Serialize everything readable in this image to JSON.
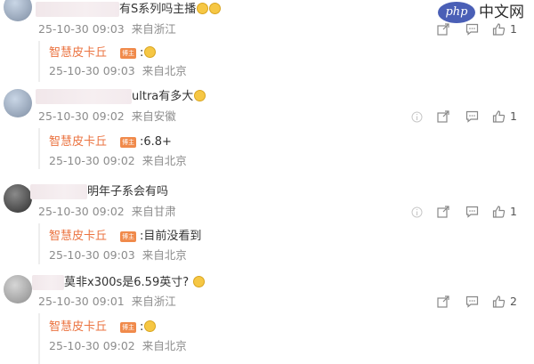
{
  "watermark": {
    "logo_text": "php",
    "site_text": "中文网"
  },
  "reply_badge": "博主",
  "comments": [
    {
      "text": "有S系列吗主播",
      "time": "25-10-30 09:03",
      "location": "来自浙江",
      "like_count": "1",
      "reply": {
        "author": "智慧皮卡丘",
        "text": ":",
        "time": "25-10-30 09:03",
        "location": "来自北京"
      }
    },
    {
      "text": "ultra有多大",
      "time": "25-10-30 09:02",
      "location": "来自安徽",
      "like_count": "1",
      "reply": {
        "author": "智慧皮卡丘",
        "text": ":6.8+",
        "time": "25-10-30 09:02",
        "location": "来自北京"
      }
    },
    {
      "text": "明年子系会有吗",
      "time": "25-10-30 09:02",
      "location": "来自甘肃",
      "like_count": "1",
      "reply": {
        "author": "智慧皮卡丘",
        "text": ":目前没看到",
        "time": "25-10-30 09:03",
        "location": "来自北京"
      }
    },
    {
      "text": "莫非x300s是6.59英寸?",
      "time": "25-10-30 09:01",
      "location": "来自浙江",
      "like_count": "2",
      "reply": {
        "author": "智慧皮卡丘",
        "text": ":",
        "time": "25-10-30 09:02",
        "location": "来自北京"
      }
    }
  ]
}
